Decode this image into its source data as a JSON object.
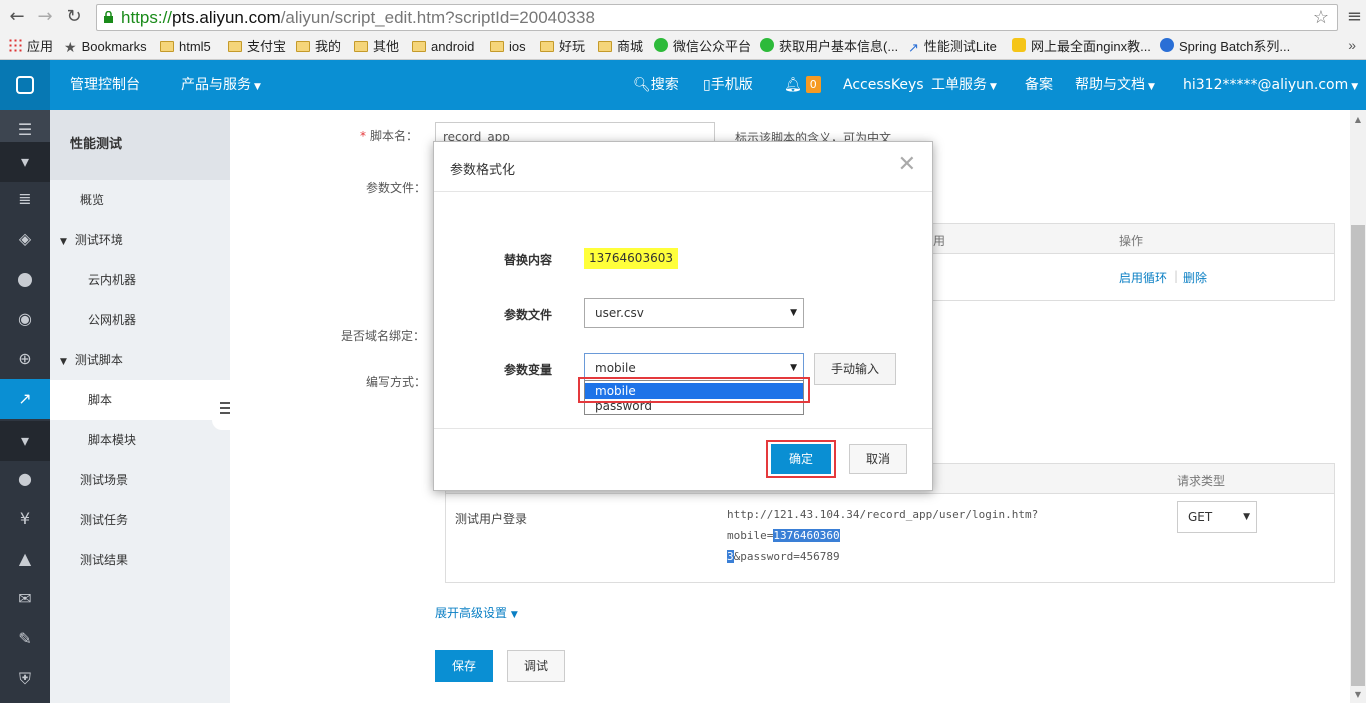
{
  "browser": {
    "url_scheme": "https://",
    "url_domain": "pts.aliyun.com",
    "url_path": "/aliyun/script_edit.htm?scriptId=20040338",
    "bookmarks": [
      {
        "label": "应用",
        "icon": "apps-icon"
      },
      {
        "label": "Bookmarks",
        "icon": "star-icon"
      },
      {
        "label": "html5",
        "icon": "folder-icon"
      },
      {
        "label": "支付宝",
        "icon": "folder-icon"
      },
      {
        "label": "我的",
        "icon": "folder-icon"
      },
      {
        "label": "其他",
        "icon": "folder-icon"
      },
      {
        "label": "android",
        "icon": "folder-icon"
      },
      {
        "label": "ios",
        "icon": "folder-icon"
      },
      {
        "label": "好玩",
        "icon": "folder-icon"
      },
      {
        "label": "商城",
        "icon": "folder-icon"
      },
      {
        "label": "微信公众平台",
        "icon": "wechat-icon"
      },
      {
        "label": "获取用户基本信息(...",
        "icon": "wechat-icon"
      },
      {
        "label": "性能测试Lite",
        "icon": "chart-icon"
      },
      {
        "label": "网上最全面nginx教...",
        "icon": "nginx-icon"
      },
      {
        "label": "Spring Batch系列...",
        "icon": "spring-icon"
      }
    ]
  },
  "topnav": {
    "console": "管理控制台",
    "products": "产品与服务",
    "search": "搜索",
    "mobile": "手机版",
    "notifications_count": "0",
    "accesskeys": "AccessKeys",
    "tickets": "工单服务",
    "record": "备案",
    "help": "帮助与文档",
    "user": "hi312*****@aliyun.com"
  },
  "sidebar": {
    "title": "性能测试",
    "items": [
      {
        "label": "概览"
      },
      {
        "label": "测试环境"
      },
      {
        "label": "云内机器"
      },
      {
        "label": "公网机器"
      },
      {
        "label": "测试脚本"
      },
      {
        "label": "脚本"
      },
      {
        "label": "脚本模块"
      },
      {
        "label": "测试场景"
      },
      {
        "label": "测试任务"
      },
      {
        "label": "测试结果"
      }
    ]
  },
  "form": {
    "script_name_label": "脚本名：",
    "script_name_value": "record_app",
    "script_name_hint": "标示该脚本的含义，可为中文",
    "param_file_label": "参数文件：",
    "domain_bind_label": "是否域名绑定：",
    "write_mode_label": "编写方式：",
    "param_table": {
      "col_use": "用",
      "col_action": "操作",
      "action_loop": "启用循环",
      "action_delete": "删除"
    },
    "request_table": {
      "col_type": "请求类型",
      "row_name": "测试用户登录",
      "url_prefix": "http://121.43.104.34/record_app/user/login.htm?mobile=",
      "url_hl_1": "1376460360",
      "url_hl_2": "3",
      "url_suffix": "&password=456789",
      "method": "GET"
    },
    "advanced": "展开高级设置",
    "save": "保存",
    "debug": "调试"
  },
  "modal": {
    "title": "参数格式化",
    "replace_label": "替换内容",
    "replace_value": "13764603603",
    "file_label": "参数文件",
    "file_value": "user.csv",
    "var_label": "参数变量",
    "var_value": "mobile",
    "var_options": [
      "mobile",
      "password"
    ],
    "manual_input": "手动输入",
    "ok": "确定",
    "cancel": "取消"
  }
}
